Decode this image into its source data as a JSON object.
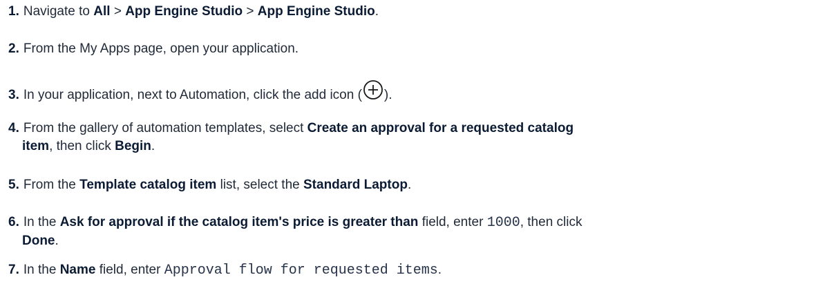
{
  "steps": [
    {
      "number": "1.",
      "text_a": "Navigate to ",
      "b1": "All",
      "text_b": " > ",
      "b2": "App Engine Studio",
      "text_c": " > ",
      "b3": "App Engine Studio",
      "text_d": "."
    },
    {
      "number": "2.",
      "text_a": "From the My Apps page, open your application."
    },
    {
      "number": "3.",
      "text_a": "In your application, next to Automation, click the add icon (",
      "icon": "add-circle-icon",
      "text_b": ")."
    },
    {
      "number": "4.",
      "text_a": "From the gallery of automation templates, select ",
      "b1": "Create an approval for a requested catalog",
      "b2": "item",
      "text_b": ", then click ",
      "b3": "Begin",
      "text_c": "."
    },
    {
      "number": "5.",
      "text_a": "From the ",
      "b1": "Template catalog item",
      "text_b": " list, select the ",
      "b2": "Standard Laptop",
      "text_c": "."
    },
    {
      "number": "6.",
      "text_a": "In the ",
      "b1": "Ask for approval if the catalog item's price is greater than",
      "text_b": " field, enter ",
      "code": "1000",
      "text_c": ", then click",
      "b2": "Done",
      "text_d": "."
    },
    {
      "number": "7.",
      "text_a": "In the ",
      "b1": "Name",
      "text_b": " field, enter ",
      "code": "Approval flow for requested items",
      "text_c": "."
    }
  ],
  "colors": {
    "body_text": "#1f2937",
    "bold_text": "#0b1b33"
  }
}
